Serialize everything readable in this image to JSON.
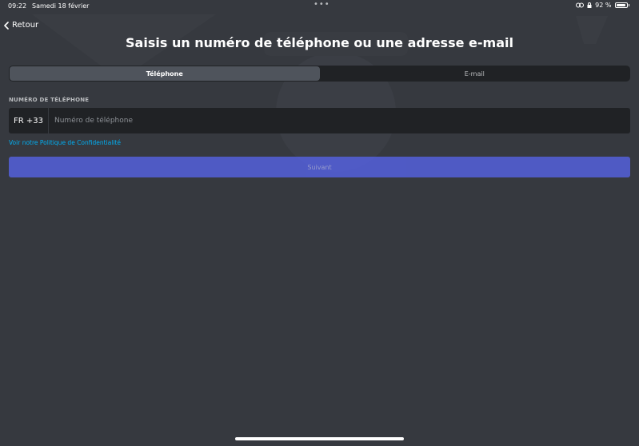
{
  "status_bar": {
    "time": "09:22",
    "date": "Samedi 18 février",
    "dots": "•••",
    "battery_percent": "92 %",
    "battery_level": 0.92
  },
  "header": {
    "back_label": "Retour",
    "title": "Saisis un numéro de téléphone ou une adresse e-mail"
  },
  "tabs": [
    {
      "label": "Téléphone",
      "active": true
    },
    {
      "label": "E-mail",
      "active": false
    }
  ],
  "phone_field": {
    "label": "NUMÉRO DE TÉLÉPHONE",
    "country_code": "FR +33",
    "placeholder": "Numéro de téléphone",
    "value": ""
  },
  "privacy_link": "Voir notre Politique de Confidentialité",
  "next_button": "Suivant",
  "colors": {
    "background": "#36393f",
    "input_bg": "#202225",
    "accent": "#5865f2",
    "link": "#00b0f4",
    "active_tab": "#4f545c"
  }
}
